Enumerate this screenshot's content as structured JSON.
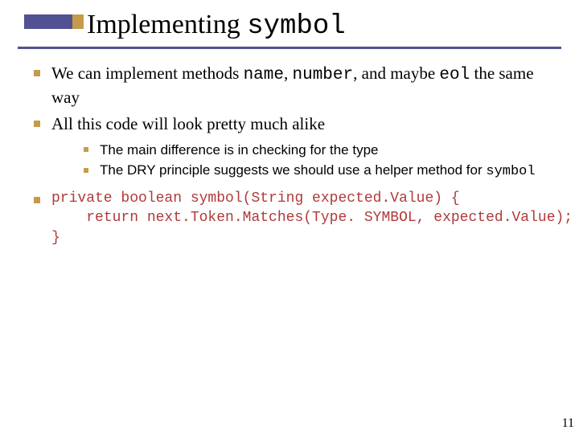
{
  "title": {
    "plain": "Implementing ",
    "code": "symbol"
  },
  "bullets": [
    {
      "pre": "We can implement methods  ",
      "code1": "name",
      "sep1": ",  ",
      "code2": "number",
      "sep2": ", and maybe  ",
      "code3": "eol",
      "post": " the same way"
    },
    {
      "text": "All this code will look pretty much alike",
      "sub": [
        "The main difference is in checking for the type",
        {
          "pre": "The DRY principle suggests we should use a helper method for ",
          "code": "symbol"
        }
      ]
    },
    {
      "code": "private boolean symbol(String expected.Value) {\n    return next.Token.Matches(Type. SYMBOL, expected.Value);\n}"
    }
  ],
  "page_number": "11"
}
